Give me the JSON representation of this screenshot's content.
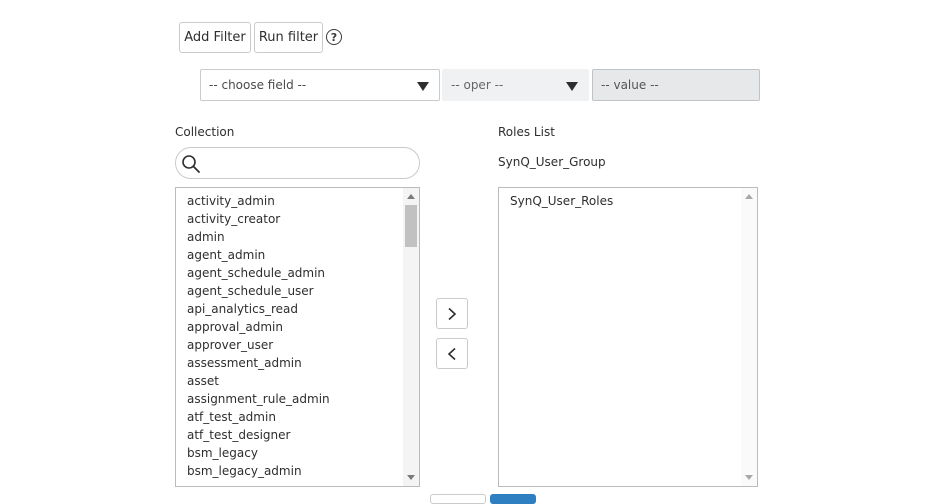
{
  "filter": {
    "add_filter_label": "Add Filter",
    "run_filter_label": "Run filter",
    "help_glyph": "?",
    "field_placeholder": "-- choose field --",
    "oper_placeholder": "-- oper --",
    "value_placeholder": "-- value --"
  },
  "collection": {
    "label": "Collection",
    "search_value": "",
    "items": [
      "activity_admin",
      "activity_creator",
      "admin",
      "agent_admin",
      "agent_schedule_admin",
      "agent_schedule_user",
      "api_analytics_read",
      "approval_admin",
      "approver_user",
      "assessment_admin",
      "asset",
      "assignment_rule_admin",
      "atf_test_admin",
      "atf_test_designer",
      "bsm_legacy",
      "bsm_legacy_admin"
    ]
  },
  "roles": {
    "label": "Roles List",
    "group_name": "SynQ_User_Group",
    "items": [
      "SynQ_User_Roles"
    ]
  },
  "icons": {
    "search": "search-icon",
    "move_right": "chevron-right-icon",
    "move_left": "chevron-left-icon",
    "dropdown": "caret-down-icon"
  }
}
